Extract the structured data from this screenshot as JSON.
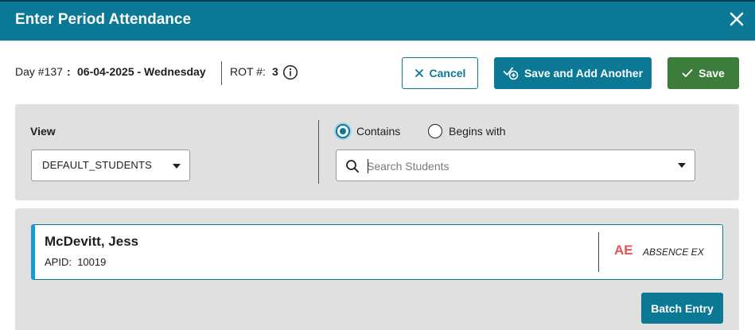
{
  "dialog": {
    "title": "Enter Period Attendance"
  },
  "info": {
    "day_label": "Day #137",
    "separator": ":",
    "date": "06-04-2025 - Wednesday",
    "rot_label": "ROT #:",
    "rot_value": "3"
  },
  "actions": {
    "cancel_label": "Cancel",
    "save_add_label": "Save and Add Another",
    "save_label": "Save"
  },
  "filters": {
    "view_label": "View",
    "view_value": "DEFAULT_STUDENTS",
    "match_options": [
      {
        "label": "Contains",
        "checked": true
      },
      {
        "label": "Begins with",
        "checked": false
      }
    ],
    "search_placeholder": "Search Students",
    "search_value": ""
  },
  "students": [
    {
      "name": "McDevitt, Jess",
      "apid_label": "APID:",
      "apid": "10019",
      "attendance_code": "AE",
      "attendance_desc": "ABSENCE EX"
    }
  ],
  "batch_entry_label": "Batch Entry",
  "colors": {
    "header": "#0b7896",
    "primary": "#0b7896",
    "save": "#3d7d3c",
    "absence_code": "#e05555",
    "panel_bg": "#e0e0e0"
  },
  "icons": {
    "close": "close-icon",
    "info": "info-icon",
    "cancel": "x-icon",
    "save_add": "check-plus-icon",
    "save": "check-icon",
    "search": "search-icon",
    "dropdown": "chevron-down-icon"
  }
}
